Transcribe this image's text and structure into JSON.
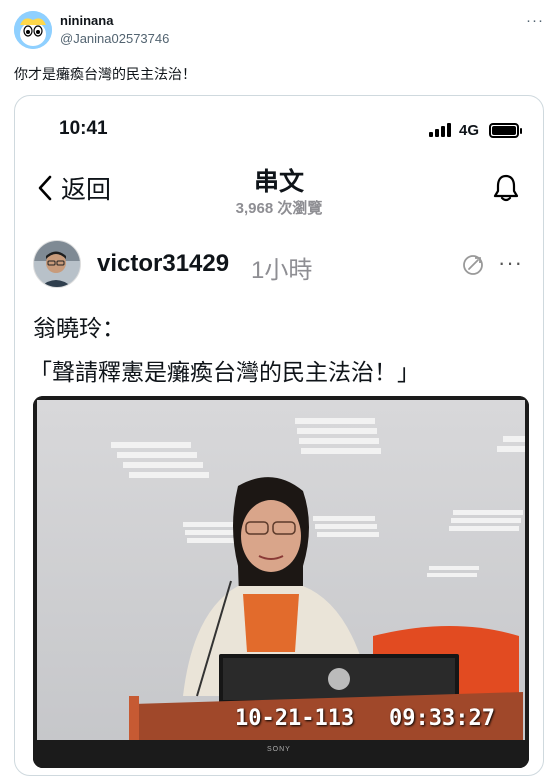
{
  "tweet": {
    "author_name": "nininana",
    "author_handle": "@Janina02573746",
    "text": "你才是癱瘓台灣的民主法治！",
    "more": "···"
  },
  "screenshot": {
    "status_time": "10:41",
    "network": "4G",
    "back_label": "返回",
    "title": "串文",
    "views": "3,968 次瀏覽",
    "post": {
      "username": "victor31429",
      "time": "1小時",
      "more": "···",
      "line1": "翁曉玲：",
      "line2": "「聲請釋憲是癱瘓台灣的民主法治！」"
    },
    "photo": {
      "date_overlay": "10-21-113",
      "time_overlay": "09:33:27",
      "brand": "SONY"
    }
  }
}
